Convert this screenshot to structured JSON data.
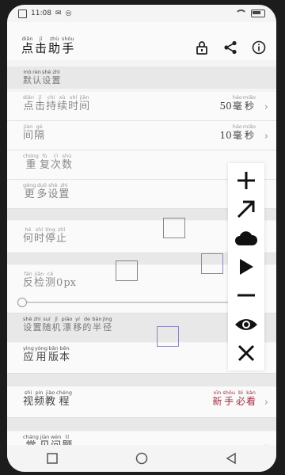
{
  "status": {
    "time": "11:08"
  },
  "header": {
    "title": [
      {
        "py": "diǎn",
        "hz": "点"
      },
      {
        "py": "jī",
        "hz": "击"
      },
      {
        "py": "zhù",
        "hz": "助"
      },
      {
        "py": "shǒu",
        "hz": "手"
      }
    ],
    "lock_icon": "lock-icon",
    "share_icon": "share-icon",
    "info_icon": "info-icon"
  },
  "sections": {
    "default": [
      {
        "py": "mò",
        "hz": "默"
      },
      {
        "py": "rèn",
        "hz": "认"
      },
      {
        "py": "shè",
        "hz": "设"
      },
      {
        "py": "zhì",
        "hz": "置"
      }
    ]
  },
  "rows": {
    "click_duration": {
      "label": [
        {
          "py": "diǎn",
          "hz": "点"
        },
        {
          "py": "jī",
          "hz": "击"
        },
        {
          "py": "chí",
          "hz": "持"
        },
        {
          "py": "xù",
          "hz": "续"
        },
        {
          "py": "shí",
          "hz": "时"
        },
        {
          "py": "jiān",
          "hz": "间"
        }
      ],
      "value": [
        {
          "py": "",
          "hz": "50"
        },
        {
          "py": "háo",
          "hz": "毫"
        },
        {
          "py": "miǎo",
          "hz": "秒"
        }
      ]
    },
    "interval": {
      "label": [
        {
          "py": "jiàn",
          "hz": "间"
        },
        {
          "py": "gé",
          "hz": "隔"
        }
      ],
      "value": [
        {
          "py": "",
          "hz": "10"
        },
        {
          "py": "háo",
          "hz": "毫"
        },
        {
          "py": "miǎo",
          "hz": "秒"
        }
      ]
    },
    "repeat": {
      "label": [
        {
          "py": "chóng",
          "hz": "重"
        },
        {
          "py": "fù",
          "hz": "复"
        },
        {
          "py": "cì",
          "hz": "次"
        },
        {
          "py": "shù",
          "hz": "数"
        }
      ]
    },
    "more": {
      "label": [
        {
          "py": "gèng",
          "hz": "更"
        },
        {
          "py": "duō",
          "hz": "多"
        },
        {
          "py": "shè",
          "hz": "设"
        },
        {
          "py": "zhì",
          "hz": "置"
        }
      ]
    },
    "stop_when": {
      "label": [
        {
          "py": "hé",
          "hz": "何"
        },
        {
          "py": "shí",
          "hz": "时"
        },
        {
          "py": "tíng",
          "hz": "停"
        },
        {
          "py": "zhǐ",
          "hz": "止"
        }
      ]
    },
    "anti_detect": {
      "label": [
        {
          "py": "fǎn",
          "hz": "反"
        },
        {
          "py": "jiǎn",
          "hz": "检"
        },
        {
          "py": "cè",
          "hz": "测"
        },
        {
          "py": "",
          "hz": "0"
        },
        {
          "py": "",
          "hz": "px"
        }
      ]
    },
    "random_radius": {
      "label": [
        {
          "py": "shè",
          "hz": "设"
        },
        {
          "py": "zhì",
          "hz": "置"
        },
        {
          "py": "suí",
          "hz": "随"
        },
        {
          "py": "jī",
          "hz": "机"
        },
        {
          "py": "piāo",
          "hz": "漂"
        },
        {
          "py": "yí",
          "hz": "移"
        },
        {
          "py": "de",
          "hz": "的"
        },
        {
          "py": "bàn",
          "hz": "半"
        },
        {
          "py": "jìng",
          "hz": "径"
        }
      ]
    },
    "app_version": {
      "label": [
        {
          "py": "yìng",
          "hz": "应"
        },
        {
          "py": "yòng",
          "hz": "用"
        },
        {
          "py": "bǎn",
          "hz": "版"
        },
        {
          "py": "běn",
          "hz": "本"
        }
      ]
    },
    "video_tutorial": {
      "label": [
        {
          "py": "shì",
          "hz": "视"
        },
        {
          "py": "pín",
          "hz": "频"
        },
        {
          "py": "jiào",
          "hz": "教"
        },
        {
          "py": "chéng",
          "hz": "程"
        }
      ],
      "value": [
        {
          "py": "xīn",
          "hz": "新"
        },
        {
          "py": "shǒu",
          "hz": "手"
        },
        {
          "py": "bì",
          "hz": "必"
        },
        {
          "py": "kàn",
          "hz": "看"
        }
      ]
    },
    "faq": {
      "label": [
        {
          "py": "cháng",
          "hz": "常"
        },
        {
          "py": "jiàn",
          "hz": "见"
        },
        {
          "py": "wèn",
          "hz": "问"
        },
        {
          "py": "tí",
          "hz": "题"
        }
      ]
    }
  },
  "panel": {
    "buttons": [
      "plus-icon",
      "arrow-up-right-icon",
      "cloud-icon",
      "play-icon",
      "minus-icon",
      "eye-icon",
      "close-icon"
    ]
  },
  "colors": {
    "accent_red": "#a03040",
    "background": "#f4f4f4"
  }
}
